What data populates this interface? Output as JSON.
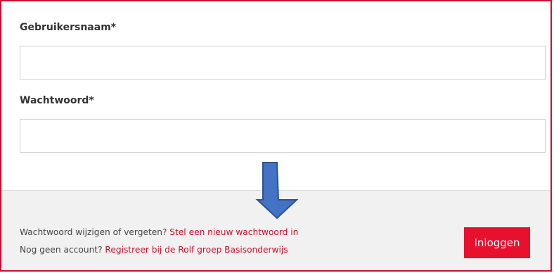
{
  "form": {
    "username_label": "Gebruikersnaam*",
    "username_value": "",
    "password_label": "Wachtwoord*",
    "password_value": ""
  },
  "footer": {
    "forgot_text": "Wachtwoord wijzigen of vergeten?",
    "forgot_link": "Stel een nieuw wachtwoord in",
    "register_text": "Nog geen account?",
    "register_link": "Registreer bij de Rolf groep Basisonderwijs",
    "login_label": "Inloggen"
  },
  "annotation": {
    "arrow_icon": "down-arrow-icon",
    "arrow_color": "#4472c4"
  },
  "colors": {
    "accent": "#c8102e",
    "button": "#e8112d",
    "footer_bg": "#f1f1f1"
  }
}
